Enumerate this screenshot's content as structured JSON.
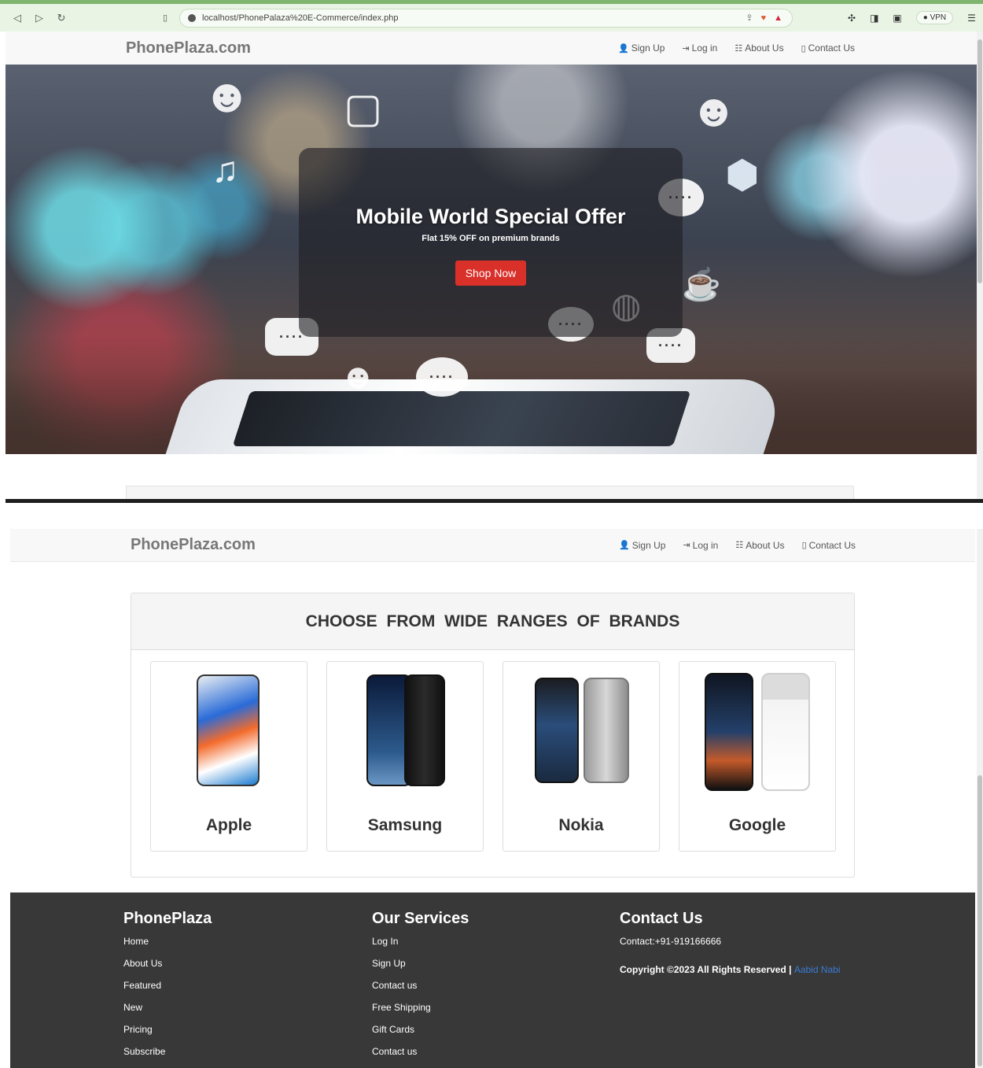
{
  "browser": {
    "url": "localhost/PhonePalaza%20E-Commerce/index.php",
    "vpn_label": "VPN"
  },
  "navbar": {
    "brand": "PhonePlaza.com",
    "links": [
      {
        "label": "Sign Up",
        "icon": "user-icon"
      },
      {
        "label": "Log in",
        "icon": "login-icon"
      },
      {
        "label": "About Us",
        "icon": "list-icon"
      },
      {
        "label": "Contact Us",
        "icon": "phone-icon"
      }
    ]
  },
  "hero": {
    "title": "Mobile World Special Offer",
    "subtitle": "Flat 15% OFF on premium brands",
    "button_label": "Shop Now",
    "bubble_text": "····"
  },
  "brands": {
    "heading": "CHOOSE FROM WIDE RANGES OF BRANDS",
    "items": [
      {
        "name": "Apple"
      },
      {
        "name": "Samsung"
      },
      {
        "name": "Nokia"
      },
      {
        "name": "Google"
      }
    ]
  },
  "footer": {
    "col1": {
      "title": "PhonePlaza",
      "links": [
        "Home",
        "About Us",
        "Featured",
        "New",
        "Pricing",
        "Subscribe"
      ]
    },
    "col2": {
      "title": "Our Services",
      "links": [
        "Log In",
        "Sign Up",
        "Contact us",
        "Free Shipping",
        "Gift Cards",
        "Contact us"
      ]
    },
    "col3": {
      "title": "Contact Us",
      "contact": "Contact:+91-919166666",
      "copyright": "Copyright ©2023 All Rights Reserved | ",
      "author": "Aabid Nabi"
    }
  },
  "colors": {
    "accent_button": "#d9302a",
    "footer_bg": "#383838",
    "author_link": "#3a7bd5"
  }
}
